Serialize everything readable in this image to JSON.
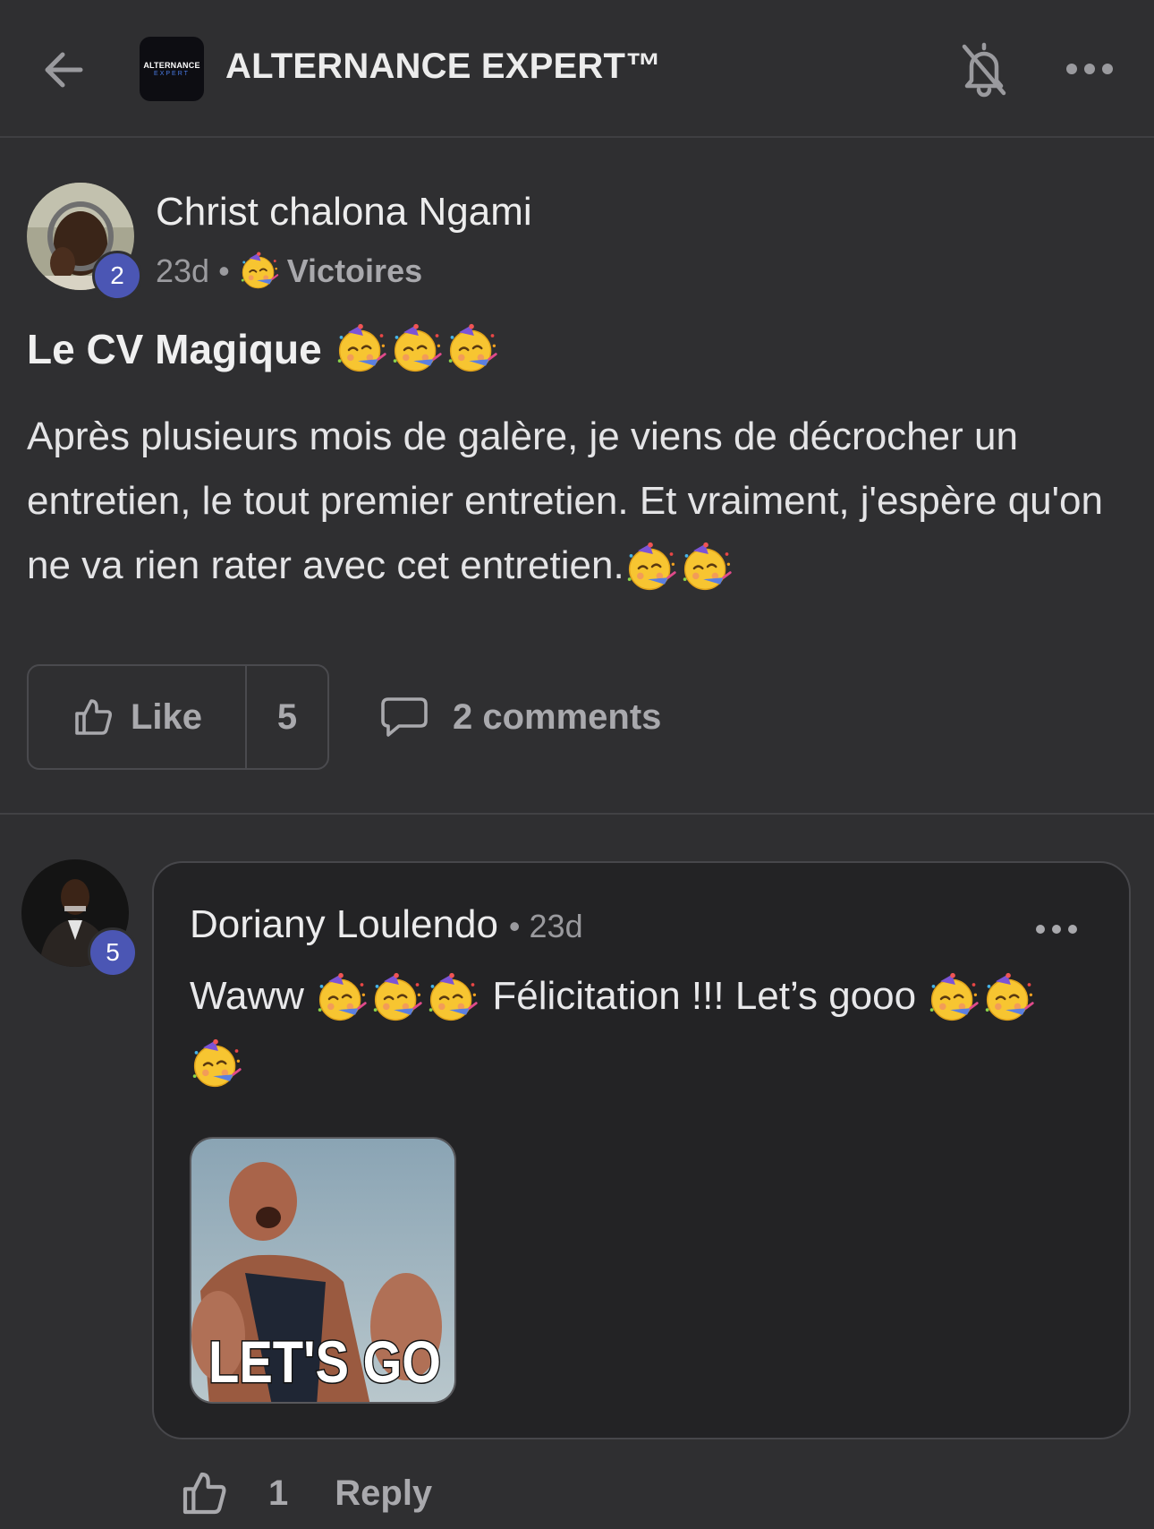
{
  "header": {
    "back_icon": "arrow-left-icon",
    "group_logo_line1": "ALTERNANCE",
    "group_logo_line2": "EXPERT",
    "group_name": "ALTERNANCE EXPERT™",
    "bell_icon": "bell-off-icon",
    "more_icon": "more-horizontal-icon"
  },
  "post": {
    "author": "Christ chalona Ngami",
    "author_level": "2",
    "time": "23d",
    "separator": "•",
    "category": "Victoires",
    "title": "Le CV Magique",
    "body": "Après plusieurs mois de galère, je viens de décrocher un entretien, le tout premier entretien. Et vraiment, j'espère qu'on ne va rien rater avec cet entretien.",
    "like_label": "Like",
    "like_count": "5",
    "comments_label": "2 comments",
    "emoji": "partying-face"
  },
  "comment": {
    "author": "Doriany Loulendo",
    "author_level": "5",
    "time": "• 23d",
    "text_part1": "Waww",
    "text_part2": "Félicitation !!! Let’s gooo",
    "gif_caption": "LET'S GO",
    "like_count": "1",
    "reply_label": "Reply"
  },
  "colors": {
    "background": "#2f2f31",
    "card": "#232325",
    "badge": "#4b56b4",
    "muted_text": "#a9a9ad"
  }
}
